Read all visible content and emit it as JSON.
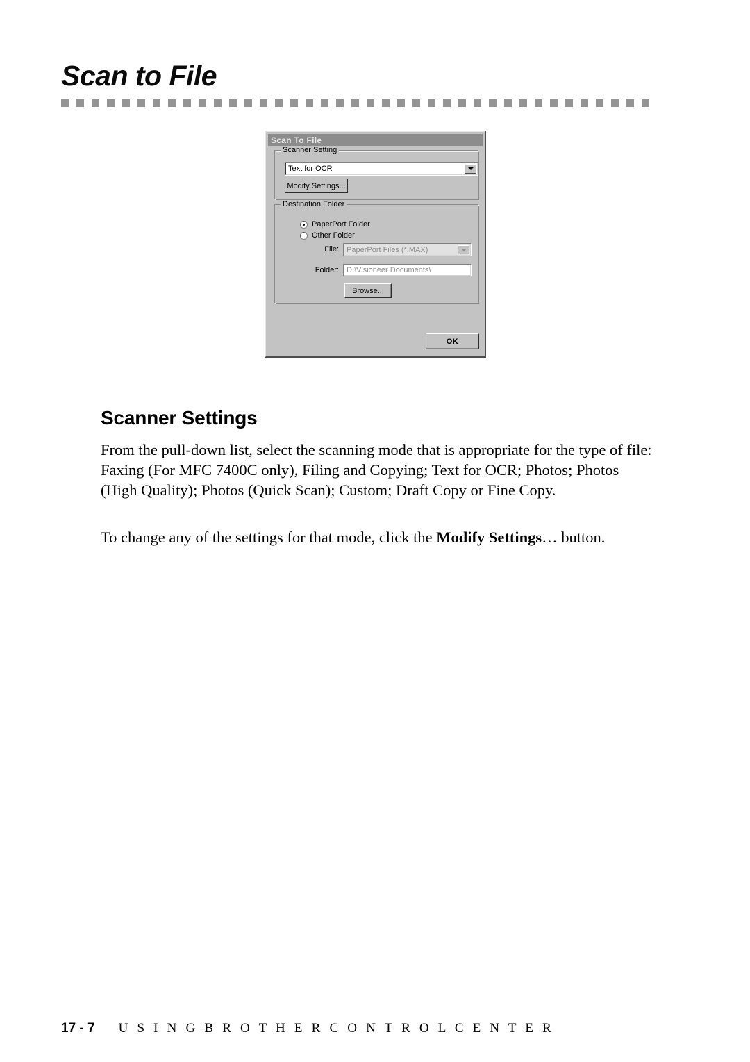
{
  "page": {
    "title": "Scan to File",
    "section_heading": "Scanner Settings",
    "paragraph_1_part_1": "From the pull-down list, select the scanning mode that is appropriate for the type of file:  Faxing (For MFC 7400C only), Filing and Copying; Text for OCR; Photos; Photos (High Quality); Photos (Quick Scan); Custom; Draft Copy or Fine Copy.",
    "paragraph_2_lead": "To change any of the settings for that mode, click the ",
    "paragraph_2_bold": "Modify Settings",
    "paragraph_2_tail": "… button."
  },
  "footer": {
    "page_number": "17 - 7",
    "section_title": "U S I N G   B R O T H E R   C O N T R O L   C E N T E R"
  },
  "dialog": {
    "title": "Scan To File",
    "scanner_setting": {
      "group_label": "Scanner Setting",
      "selected_mode": "Text for OCR",
      "modify_button": "Modify Settings..."
    },
    "destination_folder": {
      "group_label": "Destination Folder",
      "radio_paperport": "PaperPort Folder",
      "radio_other": "Other Folder",
      "radio_selected": "PaperPort Folder",
      "file_label": "File:",
      "file_value": "PaperPort Files (*.MAX)",
      "folder_label": "Folder:",
      "folder_value": "D:\\Visioneer Documents\\",
      "browse_button": "Browse..."
    },
    "ok_button": "OK"
  },
  "colors": {
    "dialog_face": "#c3c3c3",
    "titlebar_inactive": "#8c8c8c",
    "rule_dash": "#949494",
    "disabled_text": "#8f8f8f"
  }
}
